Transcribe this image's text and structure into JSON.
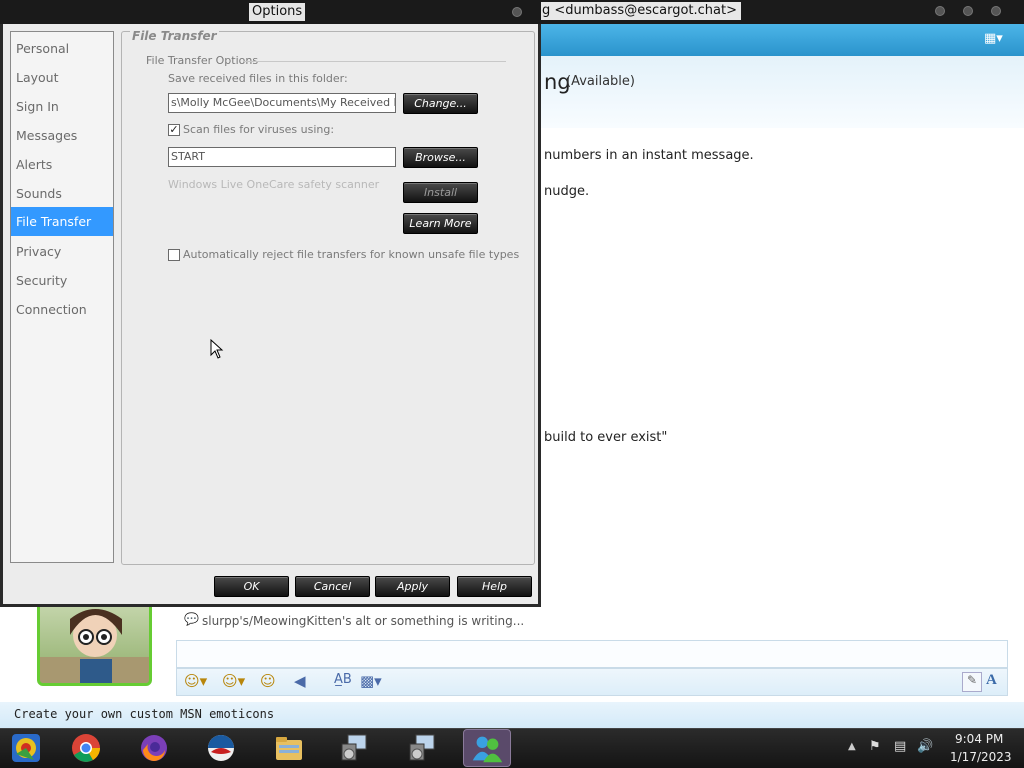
{
  "background_window": {
    "title": "g <dumbass@escargot.chat>",
    "contact_name": "ng",
    "contact_status": "(Available)",
    "chat_lines": [
      "numbers in an instant message.",
      "nudge.",
      "build to ever exist\""
    ],
    "typing_status": "slurpp's/MeowingKitten's alt or something is writing...",
    "promo": "Create your own custom MSN emoticons",
    "font_button": "A"
  },
  "dialog": {
    "title": "Options",
    "nav_items": [
      {
        "label": "Personal",
        "selected": false
      },
      {
        "label": "Layout",
        "selected": false
      },
      {
        "label": "Sign In",
        "selected": false
      },
      {
        "label": "Messages",
        "selected": false
      },
      {
        "label": "Alerts",
        "selected": false
      },
      {
        "label": "Sounds",
        "selected": false
      },
      {
        "label": "File Transfer",
        "selected": true
      },
      {
        "label": "Privacy",
        "selected": false
      },
      {
        "label": "Security",
        "selected": false
      },
      {
        "label": "Connection",
        "selected": false
      }
    ],
    "panel_title": "File Transfer",
    "group_label": "File Transfer Options",
    "save_label": "Save received files in this folder:",
    "save_path": "s\\Molly McGee\\Documents\\My Received Files",
    "change_label": "Change...",
    "scan_checked": true,
    "scan_label": "Scan files for viruses using:",
    "scanner_value": "START",
    "browse_label": "Browse...",
    "onecare_label": "Windows Live OneCare safety scanner",
    "install_label": "Install",
    "learn_more_label": "Learn More",
    "reject_checked": false,
    "reject_label": "Automatically reject file transfers for known unsafe file types",
    "buttons": {
      "ok": "OK",
      "cancel": "Cancel",
      "apply": "Apply",
      "help": "Help"
    }
  },
  "taskbar": {
    "time": "9:04 PM",
    "date": "1/17/2023",
    "icons": [
      "start-orb-icon",
      "chrome-icon",
      "firefox-icon",
      "internet-explorer-icon",
      "file-explorer-icon",
      "msn-setup-icon",
      "msn-setup-icon",
      "msn-messenger-icon"
    ]
  },
  "colors": {
    "selection": "#3399ff",
    "toolbar_blue": "#2a93cc",
    "button_dark": "#1a1a1a",
    "avatar_border": "#66cc33"
  }
}
